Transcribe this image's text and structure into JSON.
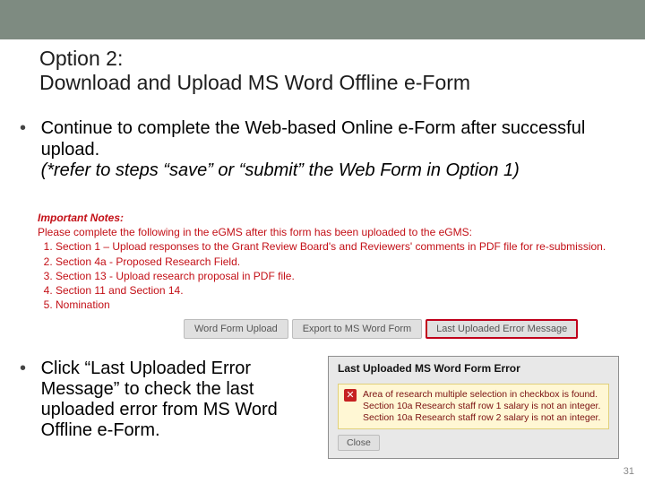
{
  "title": "Option 2:\nDownload and Upload MS Word Offline e-Form",
  "bullet1": {
    "line1": "Continue to complete the Web-based Online e-Form after successful upload.",
    "line2": "(*refer to steps “save” or “submit” the Web Form in Option 1)"
  },
  "notes": {
    "heading": "Important Notes:",
    "intro": "Please complete the following in the eGMS after this form has been uploaded to the eGMS:",
    "items": [
      "Section 1 – Upload responses to the Grant Review Board's and Reviewers' comments in PDF file for re-submission.",
      "Section 4a - Proposed Research Field.",
      "Section 13 - Upload research proposal in PDF file.",
      "Section 11 and Section 14.",
      "Nomination"
    ]
  },
  "buttons": {
    "upload": "Word Form Upload",
    "export": "Export to MS Word Form",
    "error": "Last Uploaded Error Message"
  },
  "dialog": {
    "title": "Last Uploaded MS Word Form Error",
    "message": "Area of research multiple selection in checkbox is found.\nSection 10a Research staff row 1 salary is not an integer.\nSection 10a Research staff row 2 salary is not an integer.",
    "close": "Close"
  },
  "bullet2": "Click “Last Uploaded Error Message” to check the last uploaded error from MS Word Offline e-Form.",
  "pageno": "31"
}
